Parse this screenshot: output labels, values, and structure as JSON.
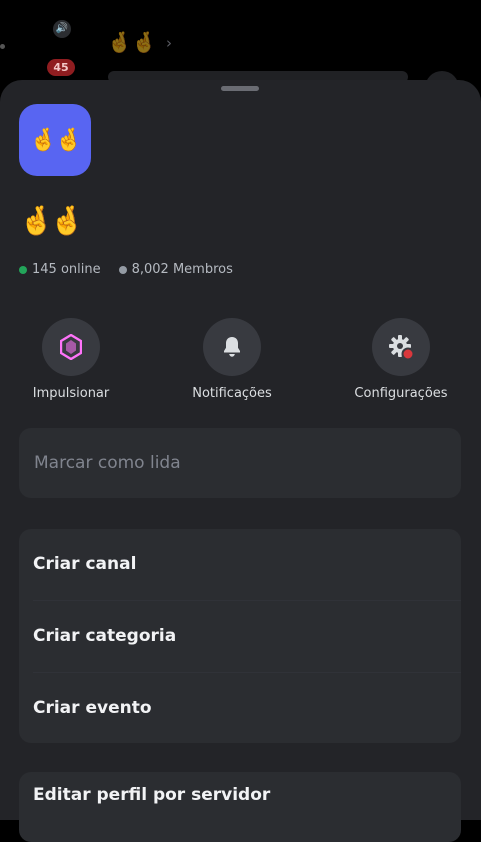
{
  "background": {
    "emoji": "🤞🤞",
    "badge": "45",
    "chevron": "›",
    "speaker": "🔊"
  },
  "server": {
    "icon_emoji": "🤞🤞",
    "name": "🤞🤞",
    "online": "145 online",
    "members": "8,002 Membros"
  },
  "actions": [
    {
      "label": "Impulsionar",
      "icon": "boost-gem-icon"
    },
    {
      "label": "Notificações",
      "icon": "bell-icon"
    },
    {
      "label": "Configurações",
      "icon": "gear-icon"
    }
  ],
  "menu": {
    "mark_read": "Marcar como lida",
    "create_channel": "Criar canal",
    "create_category": "Criar categoria",
    "create_event": "Criar evento",
    "edit_profile": "Editar perfil por servidor"
  },
  "colors": {
    "accent": "#5865f2",
    "online": "#23a55a",
    "boost": "#ff73fa",
    "alert": "#da373c"
  }
}
